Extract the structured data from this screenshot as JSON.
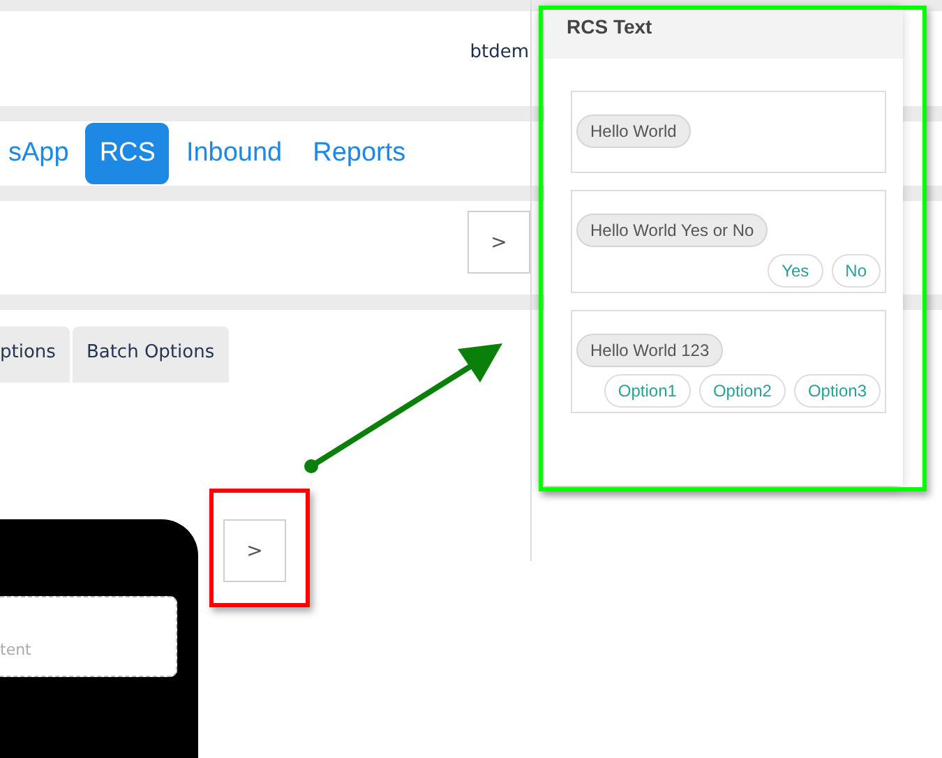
{
  "header": {
    "user": "btdem"
  },
  "nav_tabs": [
    {
      "label": "sApp",
      "selected": false
    },
    {
      "label": "RCS",
      "selected": true
    },
    {
      "label": "Inbound",
      "selected": false
    },
    {
      "label": "Reports",
      "selected": false
    }
  ],
  "toolbar": {
    "next_label": ">"
  },
  "option_tabs": [
    {
      "label": "ptions",
      "selected": false
    },
    {
      "label": "Batch Options",
      "selected": false
    }
  ],
  "phone": {
    "placeholder": "tent"
  },
  "side_next": {
    "label": ">",
    "highlighted": true
  },
  "popup": {
    "title": "RCS Text",
    "highlighted": true,
    "cards": [
      {
        "message": "Hello World"
      },
      {
        "message": "Hello World Yes or No",
        "replies": [
          "Yes",
          "No"
        ]
      },
      {
        "message": "Hello World 123",
        "replies": [
          "Option1",
          "Option2",
          "Option3"
        ]
      }
    ]
  }
}
